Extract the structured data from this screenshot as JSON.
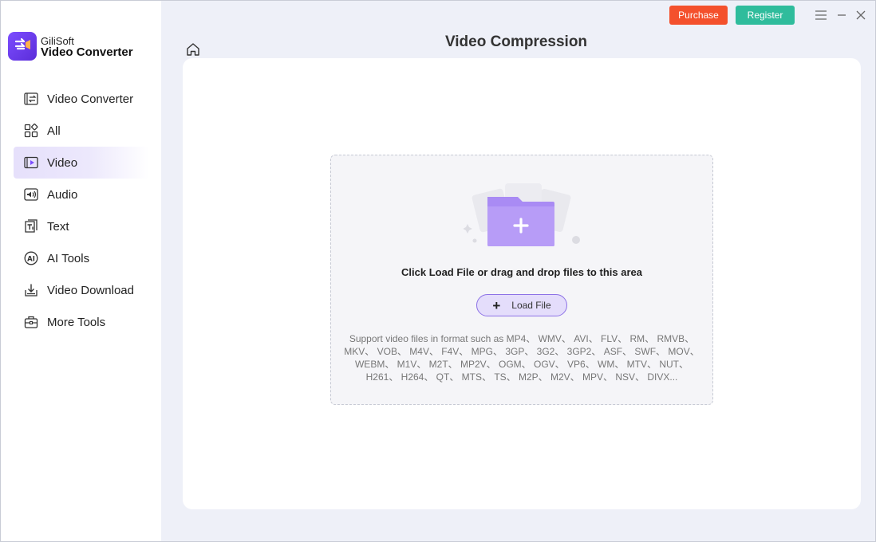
{
  "app": {
    "brand_top": "GiliSoft",
    "brand_name": "Video Converter"
  },
  "header": {
    "purchase_label": "Purchase",
    "register_label": "Register",
    "page_title": "Video Compression"
  },
  "sidebar": {
    "items": [
      {
        "label": "Video Converter",
        "icon": "video-converter-icon"
      },
      {
        "label": "All",
        "icon": "grid-icon"
      },
      {
        "label": "Video",
        "icon": "video-icon",
        "active": true
      },
      {
        "label": "Audio",
        "icon": "audio-icon"
      },
      {
        "label": "Text",
        "icon": "text-icon"
      },
      {
        "label": "AI Tools",
        "icon": "ai-icon"
      },
      {
        "label": "Video Download",
        "icon": "download-icon"
      },
      {
        "label": "More Tools",
        "icon": "toolbox-icon"
      }
    ]
  },
  "dropzone": {
    "hint": "Click Load File or drag and drop files to this area",
    "load_label": "Load File",
    "formats": "Support video files in format such as MP4、 WMV、 AVI、 FLV、 RM、 RMVB、 MKV、 VOB、 M4V、 F4V、 MPG、 3GP、 3G2、 3GP2、 ASF、 SWF、 MOV、 WEBM、 M1V、 M2T、 MP2V、 OGM、 OGV、 VP6、 WM、 MTV、 NUT、 H261、 H264、 QT、 MTS、 TS、 M2P、 M2V、 MPV、 NSV、 DIVX..."
  },
  "colors": {
    "accent": "#7c4dff",
    "purchase": "#f4502c",
    "register": "#2fbc9c"
  }
}
